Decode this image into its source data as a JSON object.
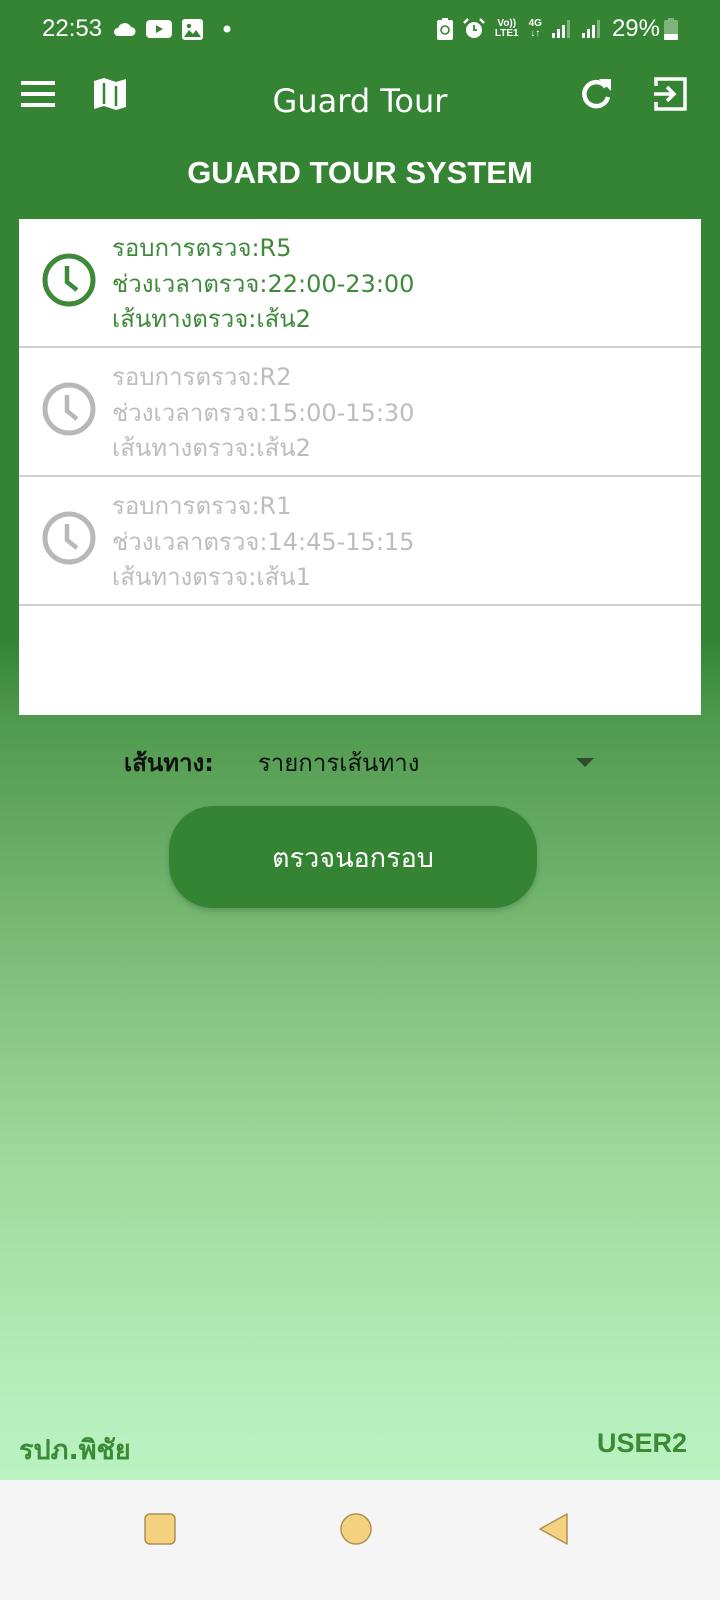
{
  "status_bar": {
    "time": "22:53",
    "left_icons": [
      "cloud-icon",
      "youtube-icon",
      "gallery-icon",
      "dot-icon"
    ],
    "right_icons": [
      "battery-saver-icon",
      "alarm-icon",
      "volte-icon",
      "4g-data-icon",
      "signal-icon",
      "signal-icon"
    ],
    "volte_top": "Vo))",
    "volte_bottom": "LTE1",
    "network": "4G",
    "battery_percent": "29%",
    "battery_level": 0.29
  },
  "app_bar": {
    "title": "Guard Tour",
    "icons": [
      "menu-icon",
      "map-icon",
      "refresh-icon",
      "logout-icon"
    ]
  },
  "system_title": "GUARD TOUR SYSTEM",
  "rounds": [
    {
      "status": "active",
      "round": "รอบการตรวจ:R5",
      "time_range": "ช่วงเวลาตรวจ:22:00-23:00",
      "route": "เส้นทางตรวจ:เส้น2"
    },
    {
      "status": "inactive",
      "round": "รอบการตรวจ:R2",
      "time_range": "ช่วงเวลาตรวจ:15:00-15:30",
      "route": "เส้นทางตรวจ:เส้น2"
    },
    {
      "status": "inactive",
      "round": "รอบการตรวจ:R1",
      "time_range": "ช่วงเวลาตรวจ:14:45-15:15",
      "route": "เส้นทางตรวจ:เส้น1"
    }
  ],
  "route_selector": {
    "label": "เส้นทาง:",
    "selected": "รายการเส้นทาง"
  },
  "offround_button": "ตรวจนอกรอบ",
  "footer": {
    "location": "รปภ.พิชัย",
    "user": "USER2"
  },
  "colors": {
    "primary": "#358434",
    "active_text": "#3f8a3a",
    "inactive_text": "#bdbdbd",
    "nav_icon": "#f5d27f"
  }
}
